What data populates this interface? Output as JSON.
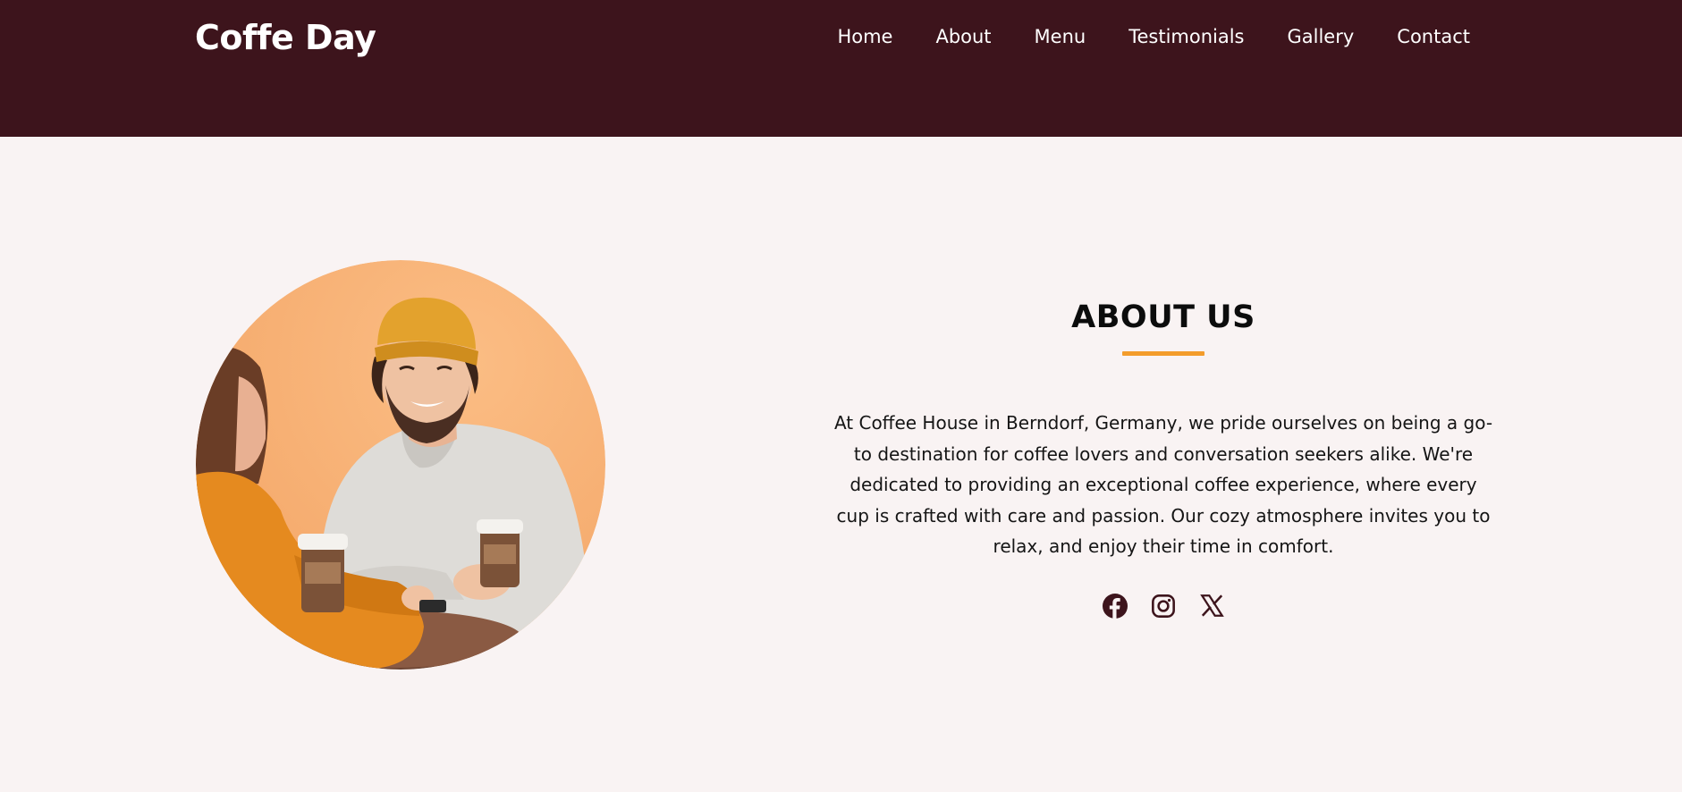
{
  "header": {
    "logo": "Coffe Day",
    "nav": [
      "Home",
      "About",
      "Menu",
      "Testimonials",
      "Gallery",
      "Contact"
    ]
  },
  "about": {
    "title": "ABOUT US",
    "text": "At Coffee House in Berndorf, Germany, we pride ourselves on being a go-to destination for coffee lovers and conversation seekers alike. We're dedicated to providing an exceptional coffee experience, where every cup is crafted with care and passion. Our cozy atmosphere invites you to relax, and enjoy their time in comfort.",
    "social": [
      "facebook-icon",
      "instagram-icon",
      "x-icon"
    ]
  },
  "colors": {
    "header_bg": "#3d141c",
    "accent": "#f39c2b",
    "page_bg": "#f9f3f3",
    "icon": "#3d141c"
  }
}
